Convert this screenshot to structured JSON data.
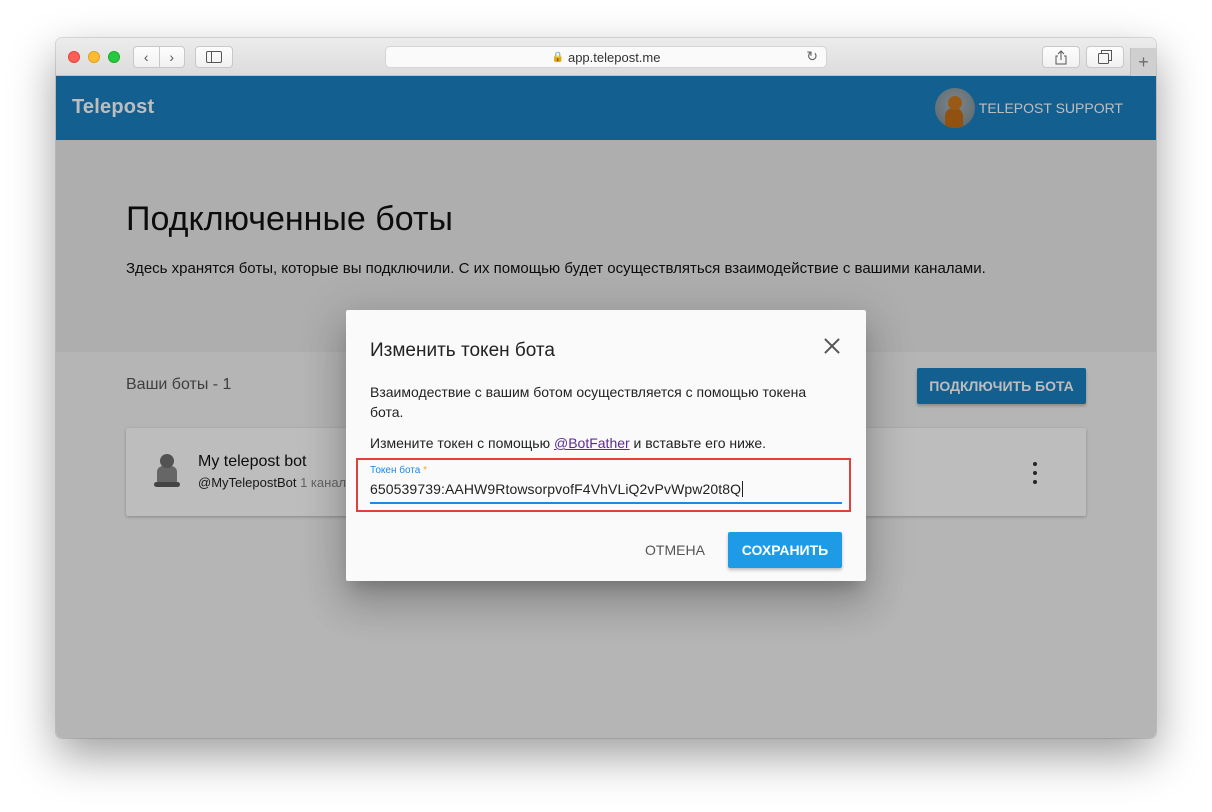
{
  "browser": {
    "url": "app.telepost.me",
    "nav_back_glyph": "‹",
    "nav_forward_glyph": "›",
    "reload_glyph": "↻",
    "new_tab_glyph": "+",
    "lock_icon": "lock-icon",
    "sidebar_icon": "sidebar-icon",
    "share_icon": "share-icon",
    "tabs_icon": "tabs-icon"
  },
  "appbar": {
    "brand": "Telepost",
    "user_name": "TELEPOST SUPPORT",
    "color": "#1a80c2"
  },
  "page": {
    "title": "Подключенные боты",
    "description": "Здесь хранятся боты, которые вы подключили. С их помощью будет осуществляться взаимодействие с вашими каналами."
  },
  "bots_section": {
    "label": "Ваши боты - 1",
    "connect_button": "ПОДКЛЮЧИТЬ БОТА",
    "bots": [
      {
        "name": "My telepost bot",
        "username": "@MyTelepostBot",
        "channels": "1 канал"
      }
    ]
  },
  "dialog": {
    "title": "Изменить токен бота",
    "text1": "Взаимодествие с вашим ботом осуществляется с помощью токена бота.",
    "text2_before": "Измените токен с помощью ",
    "text2_link": "@BotFather",
    "text2_after": " и вставьте его ниже.",
    "field_label": "Токен бота",
    "field_required_mark": "*",
    "field_value": "650539739:AAHW9RtowsorpvofF4VhVLiQ2vPvWpw20t8Q",
    "cancel_button": "ОТМЕНА",
    "save_button": "СОХРАНИТЬ",
    "accent_color": "#1e88e5",
    "highlight_color": "#e0413b"
  }
}
